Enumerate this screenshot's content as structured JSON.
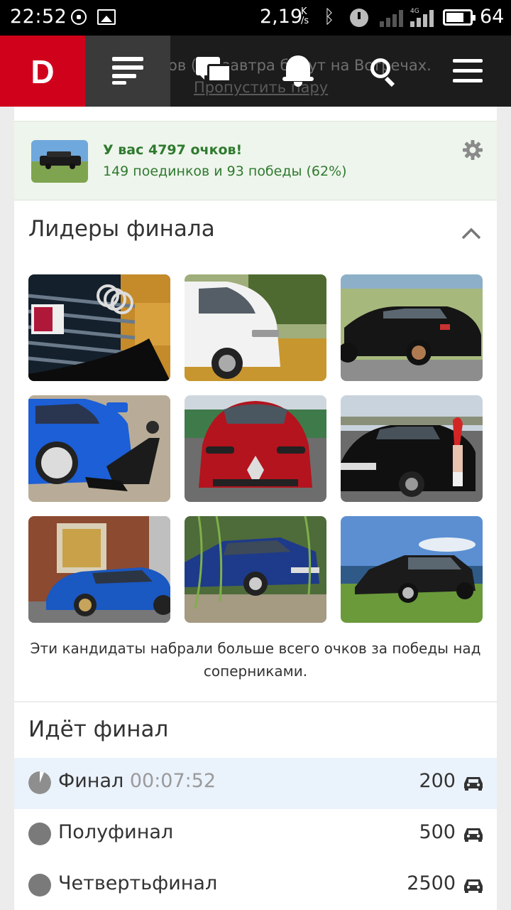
{
  "status_bar": {
    "time": "22:52",
    "net_speed": "2,19",
    "net_speed_unit_top": "K",
    "net_speed_unit_bottom": "/s",
    "network_type": "4G",
    "battery_level": "64",
    "icons": [
      "whatsapp-icon",
      "gallery-icon",
      "bluetooth-icon",
      "alarm-icon",
      "signal-icon",
      "battery-icon"
    ]
  },
  "navbar": {
    "logo": "D",
    "underlay_line_1": "ов (…) завтра будут на Встречах.",
    "underlay_link": "Пропустить пару",
    "icons": [
      "feed-icon",
      "chat-icon",
      "bell-icon",
      "search-icon",
      "menu-icon"
    ]
  },
  "score": {
    "title": "У вас 4797 очков!",
    "subtitle": "149 поединков и 93 победы (62%)"
  },
  "leaders": {
    "title": "Лидеры финала",
    "caption": "Эти кандидаты набрали больше всего очков за победы над соперниками.",
    "thumbnails": [
      {
        "name": "audi-grille"
      },
      {
        "name": "white-van"
      },
      {
        "name": "black-sedan"
      },
      {
        "name": "blue-subaru"
      },
      {
        "name": "red-alfa-romeo"
      },
      {
        "name": "black-accord"
      },
      {
        "name": "blue-golf"
      },
      {
        "name": "blue-bmw"
      },
      {
        "name": "black-mercedes"
      }
    ]
  },
  "final": {
    "title": "Идёт финал",
    "rows": [
      {
        "label": "Финал",
        "timer": "00:07:52",
        "value": "200"
      },
      {
        "label": "Полуфинал",
        "value": "500"
      },
      {
        "label": "Четвертьфинал",
        "value": "2500"
      }
    ]
  },
  "colors": {
    "brand": "#d0021b",
    "navbar": "#1c1c1c",
    "score_bg": "#eef5ec",
    "score_text": "#2f7a2f",
    "active_row": "#eaf2fb"
  }
}
